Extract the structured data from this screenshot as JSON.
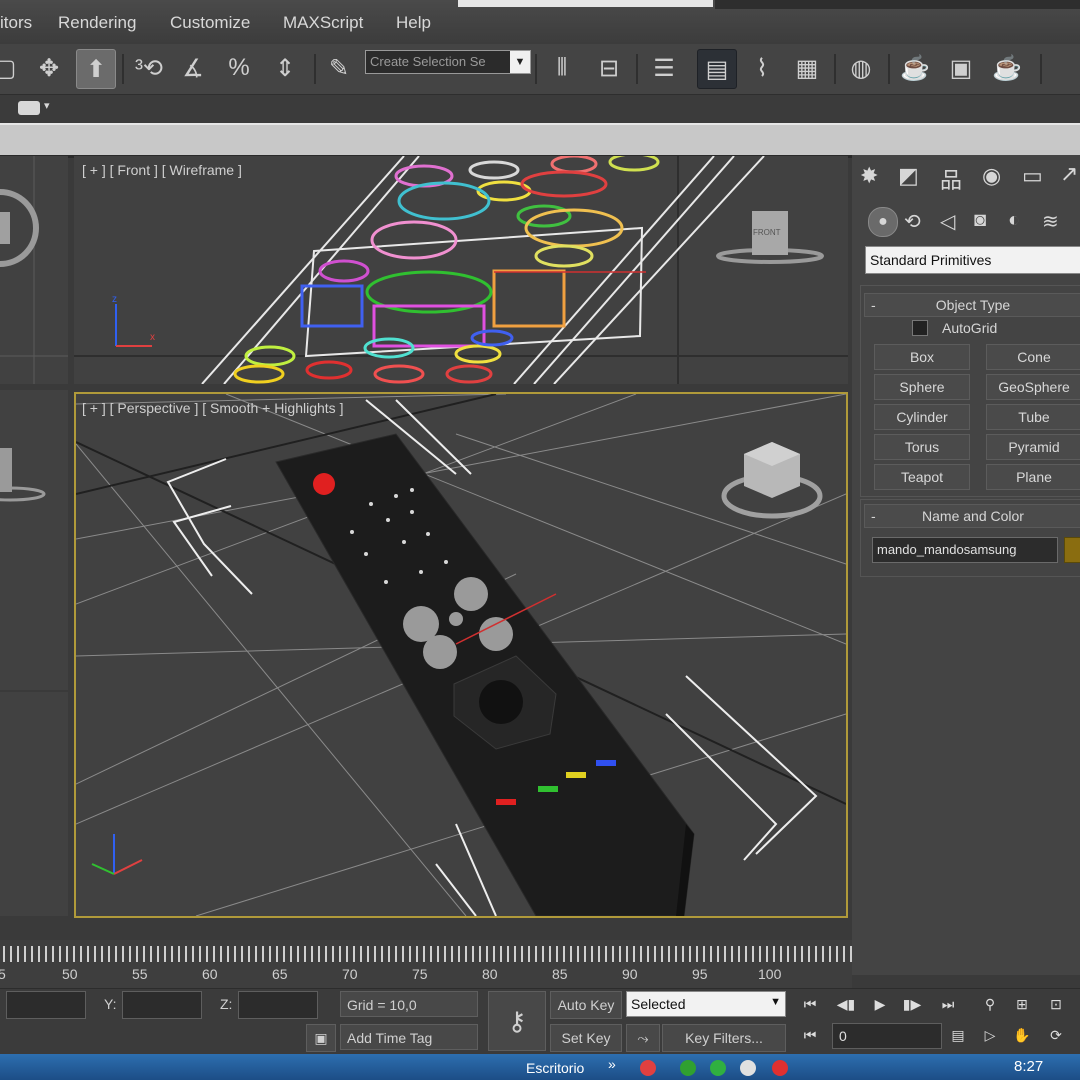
{
  "menu": {
    "items": [
      "itors",
      "Rendering",
      "Customize",
      "MAXScript",
      "Help"
    ]
  },
  "toolbar": {
    "selection_set_placeholder": "Create Selection Se",
    "icons": [
      "move-icon",
      "select-object-icon",
      "snap-3d-icon",
      "angle-snap-icon",
      "percent-snap-icon",
      "spinner-snap-icon",
      "edit-named-selection-icon",
      "mirror-icon",
      "align-icon",
      "layer-manager-icon",
      "graphite-toggle-icon",
      "curve-editor-icon",
      "schematic-view-icon",
      "material-editor-icon",
      "render-setup-icon",
      "rendered-frame-icon",
      "render-production-icon"
    ]
  },
  "viewports": {
    "front_label": "[ + ] [ Front ] [ Wireframe ]",
    "front_cube_label": "FRONT",
    "perspective_label": "[ + ] [ Perspective ] [ Smooth + Highlights ]"
  },
  "command_panel": {
    "tab_icons": [
      "create-icon",
      "modify-icon",
      "hierarchy-icon",
      "motion-icon",
      "display-icon",
      "utilities-icon"
    ],
    "category_icons": [
      "geometry-icon",
      "shapes-icon",
      "lights-icon",
      "cameras-icon",
      "helpers-icon",
      "space-warps-icon"
    ],
    "dropdown_value": "Standard Primitives",
    "object_type": {
      "title": "Object Type",
      "autogrid_label": "AutoGrid",
      "autogrid_checked": false,
      "buttons": [
        "Box",
        "Cone",
        "Sphere",
        "GeoSphere",
        "Cylinder",
        "Tube",
        "Torus",
        "Pyramid",
        "Teapot",
        "Plane"
      ]
    },
    "name_and_color": {
      "title": "Name and Color",
      "name_value": "mando_mandosamsung",
      "swatch_color": "#8a6d10"
    }
  },
  "timeline": {
    "ticks": [
      "5",
      "50",
      "55",
      "60",
      "65",
      "70",
      "75",
      "80",
      "85",
      "90",
      "95",
      "100"
    ]
  },
  "status": {
    "x_label": "",
    "y_label": "Y:",
    "z_label": "Z:",
    "grid_text": "Grid = 10,0",
    "add_time_tag": "Add Time Tag",
    "auto_key": "Auto Key",
    "set_key": "Set Key",
    "key_mode_value": "Selected",
    "key_filters": "Key Filters...",
    "frame_value": "0"
  },
  "taskbar": {
    "clock": "8:27",
    "app_text": "Escritorio"
  },
  "colors": {
    "accent_viewport_border": "#b09a3a",
    "background": "#414141"
  }
}
